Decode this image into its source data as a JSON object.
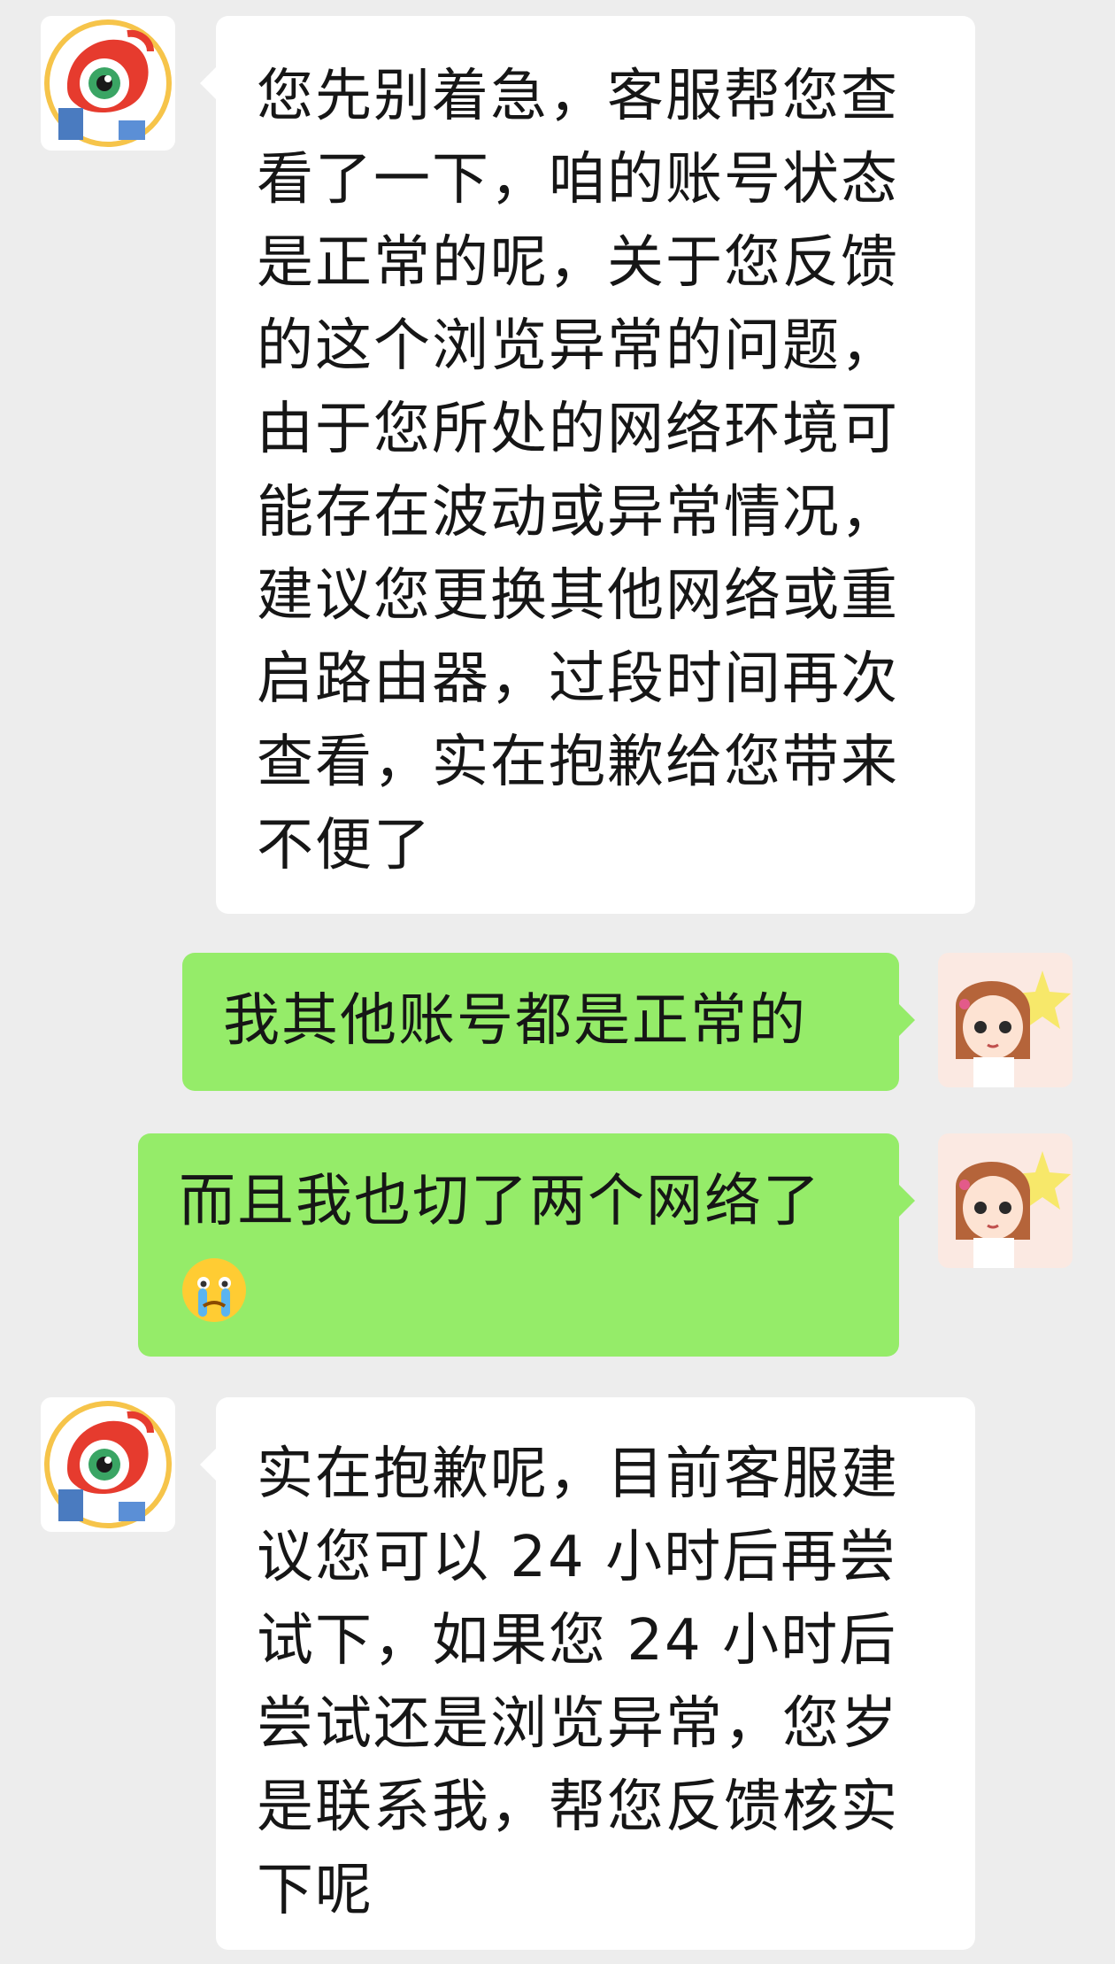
{
  "messages": [
    {
      "sender": "customer-service",
      "side": "left",
      "lines": [
        "您先别着急，客服帮您查",
        "看了一下，咱的账号状态",
        "是正常的呢，关于您反馈",
        "的这个浏览异常的问题，",
        "由于您所处的网络环境可",
        "能存在波动或异常情况，",
        "建议您更换其他网络或重",
        "启路由器，过段时间再次",
        "查看，实在抱歉给您带来",
        "不便了"
      ]
    },
    {
      "sender": "user",
      "side": "right",
      "lines": [
        "我其他账号都是正常的"
      ]
    },
    {
      "sender": "user",
      "side": "right",
      "lines": [
        "而且我也切了两个网络了"
      ],
      "emoji": "crying-face-emoji"
    },
    {
      "sender": "customer-service",
      "side": "left",
      "lines": [
        "实在抱歉呢，目前客服建",
        "议您可以 24 小时后再尝",
        "试下，如果您 24 小时后",
        "尝试还是浏览异常，您岁",
        "是联系我，帮您反馈核实",
        "下呢"
      ]
    }
  ],
  "colors": {
    "background": "#ededed",
    "incoming_bubble": "#ffffff",
    "outgoing_bubble": "#95ec69",
    "text": "#161616"
  },
  "icons": {
    "cs_avatar": "weibo-eye-mascot-avatar",
    "user_avatar": "cartoon-girl-avatar"
  }
}
